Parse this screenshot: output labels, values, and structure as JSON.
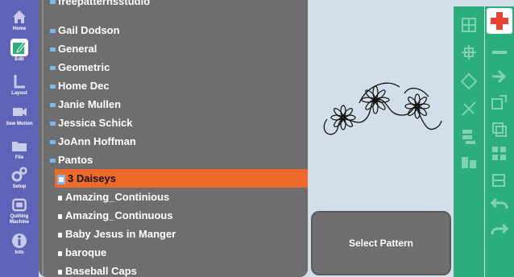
{
  "nav": {
    "items": [
      {
        "label": "Home",
        "icon": "home-icon"
      },
      {
        "label": "Edit",
        "icon": "edit-icon"
      },
      {
        "label": "Layout",
        "icon": "layout-icon"
      },
      {
        "label": "Sew Motion",
        "icon": "sew-motion-icon"
      },
      {
        "label": "File",
        "icon": "folder-icon"
      },
      {
        "label": "Setup",
        "icon": "gears-icon"
      },
      {
        "label": "Quilting Machine",
        "icon": "machine-icon"
      },
      {
        "label": "Info",
        "icon": "info-icon"
      }
    ]
  },
  "list": {
    "top_partial": "freepatternsstudio",
    "rows": [
      {
        "label": "Gail Dodson",
        "type": "folder"
      },
      {
        "label": "General",
        "type": "folder"
      },
      {
        "label": "Geometric",
        "type": "folder"
      },
      {
        "label": "Home Dec",
        "type": "folder"
      },
      {
        "label": "Janie Mullen",
        "type": "folder"
      },
      {
        "label": "Jessica Schick",
        "type": "folder"
      },
      {
        "label": "JoAnn Hoffman",
        "type": "folder"
      },
      {
        "label": "Pantos",
        "type": "folder-open"
      },
      {
        "label": "3 Daiseys",
        "type": "file-selected"
      },
      {
        "label": "Amazing_Continious",
        "type": "file"
      },
      {
        "label": "Amazing_Continuous",
        "type": "file"
      },
      {
        "label": "Baby Jesus in Manger",
        "type": "file"
      },
      {
        "label": "baroque",
        "type": "file"
      },
      {
        "label": "Baseball Caps",
        "type": "file"
      }
    ]
  },
  "preview": {
    "selected_pattern": "3 Daiseys"
  },
  "actions": {
    "select_pattern": "Select Pattern"
  },
  "tools": {
    "col1": [
      "grid-icon",
      "cross-align-icon",
      "diamond-tool-icon",
      "scissors-icon",
      "repeat-stack-icon",
      "blocks-icon"
    ],
    "col2": [
      "add-icon",
      "line-icon",
      "arrow-right-icon",
      "resize-icon",
      "copy-icon",
      "grid-resize-icon",
      "undo-icon",
      "redo-icon"
    ]
  },
  "colors": {
    "nav_bg": "#5e63b8",
    "list_bg": "#6e6e6e",
    "selection": "#ed6a2b",
    "tool_green": "#2bad7c",
    "preview_bg": "#d2deea",
    "add_red": "#e8432e"
  }
}
